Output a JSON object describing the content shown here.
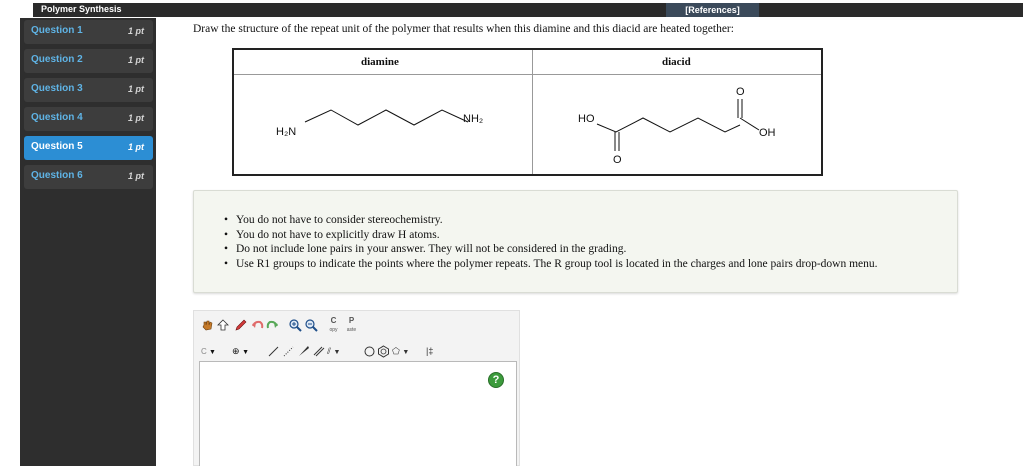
{
  "header": {
    "title": "Polymer Synthesis",
    "references_label": "[References]"
  },
  "sidebar": {
    "items": [
      {
        "label": "Question 1",
        "points": "1 pt",
        "active": false
      },
      {
        "label": "Question 2",
        "points": "1 pt",
        "active": false
      },
      {
        "label": "Question 3",
        "points": "1 pt",
        "active": false
      },
      {
        "label": "Question 4",
        "points": "1 pt",
        "active": false
      },
      {
        "label": "Question 5",
        "points": "1 pt",
        "active": true
      },
      {
        "label": "Question 6",
        "points": "1 pt",
        "active": false
      }
    ]
  },
  "question": {
    "prompt": "Draw the structure of the repeat unit of the polymer that results when this diamine and this diacid are heated together:",
    "table": {
      "col1_header": "diamine",
      "col2_header": "diacid",
      "diamine_left_group": "H₂N",
      "diamine_right_group": "NH₂",
      "diacid_left_group": "HO",
      "diacid_right_group": "OH",
      "oxygen_label": "O"
    },
    "instructions": [
      "You do not have to consider stereochemistry.",
      "You do not have to explicitly draw H atoms.",
      "Do not include lone pairs in your answer. They will not be considered in the grading.",
      "Use R1 groups to indicate the points where the polymer repeats. The R group tool is located in the charges and lone pairs drop-down menu."
    ]
  },
  "tool": {
    "copy_label": "C",
    "copy_sub": "opy",
    "paste_label": "P",
    "paste_sub": "aste",
    "carbon_label": "C",
    "help_label": "?",
    "r_group_label": "|‡"
  },
  "colors": {
    "accent_active": "#2c8ed4",
    "link_blue": "#5fb4e6",
    "sidebar_bg": "#2e2e2e"
  }
}
